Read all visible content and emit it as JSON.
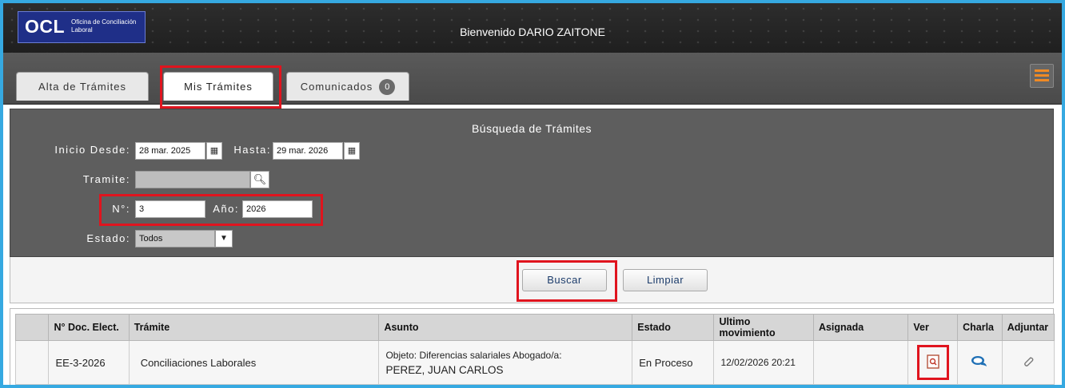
{
  "header": {
    "logo_main": "OCL",
    "logo_sub": "Oficina de Conciliación Laboral",
    "welcome": "Bienvenido DARIO ZAITONE"
  },
  "tabs": [
    {
      "label": "Alta de Trámites"
    },
    {
      "label": "Mis Trámites"
    },
    {
      "label": "Comunicados",
      "badge": "0"
    }
  ],
  "search": {
    "title": "Búsqueda de Trámites",
    "inicio_label": "Inicio Desde:",
    "inicio_value": "28 mar. 2025",
    "hasta_label": "Hasta:",
    "hasta_value": "29 mar. 2026",
    "tramite_label": "Tramite:",
    "tramite_value": "",
    "nro_label": "N°:",
    "nro_value": "3",
    "anio_label": "Año:",
    "anio_value": "2026",
    "estado_label": "Estado:",
    "estado_value": "Todos"
  },
  "buttons": {
    "buscar": "Buscar",
    "limpiar": "Limpiar"
  },
  "table": {
    "headers": [
      "",
      "N° Doc. Elect.",
      "Trámite",
      "Asunto",
      "Estado",
      "Ultimo movimiento",
      "Asignada",
      "Ver",
      "Charla",
      "Adjuntar"
    ],
    "rows": [
      {
        "doc": "EE-3-2026",
        "tramite": "Conciliaciones Laborales",
        "asunto_line1": "Objeto: Diferencias salariales Abogado/a:",
        "asunto_line2": "PEREZ, JUAN CARLOS",
        "estado": "En Proceso",
        "ultimo": "12/02/2026 20:21",
        "asignada": ""
      }
    ]
  },
  "colors": {
    "frame": "#36a9e1",
    "highlight": "#e0141e",
    "menu_accent": "#f08a24",
    "logo_bg": "#1f2f88"
  },
  "icons": [
    "calendar-icon",
    "search-icon",
    "chevron-down-icon",
    "hamburger-icon",
    "view-document-icon",
    "chat-icon",
    "paperclip-icon"
  ]
}
